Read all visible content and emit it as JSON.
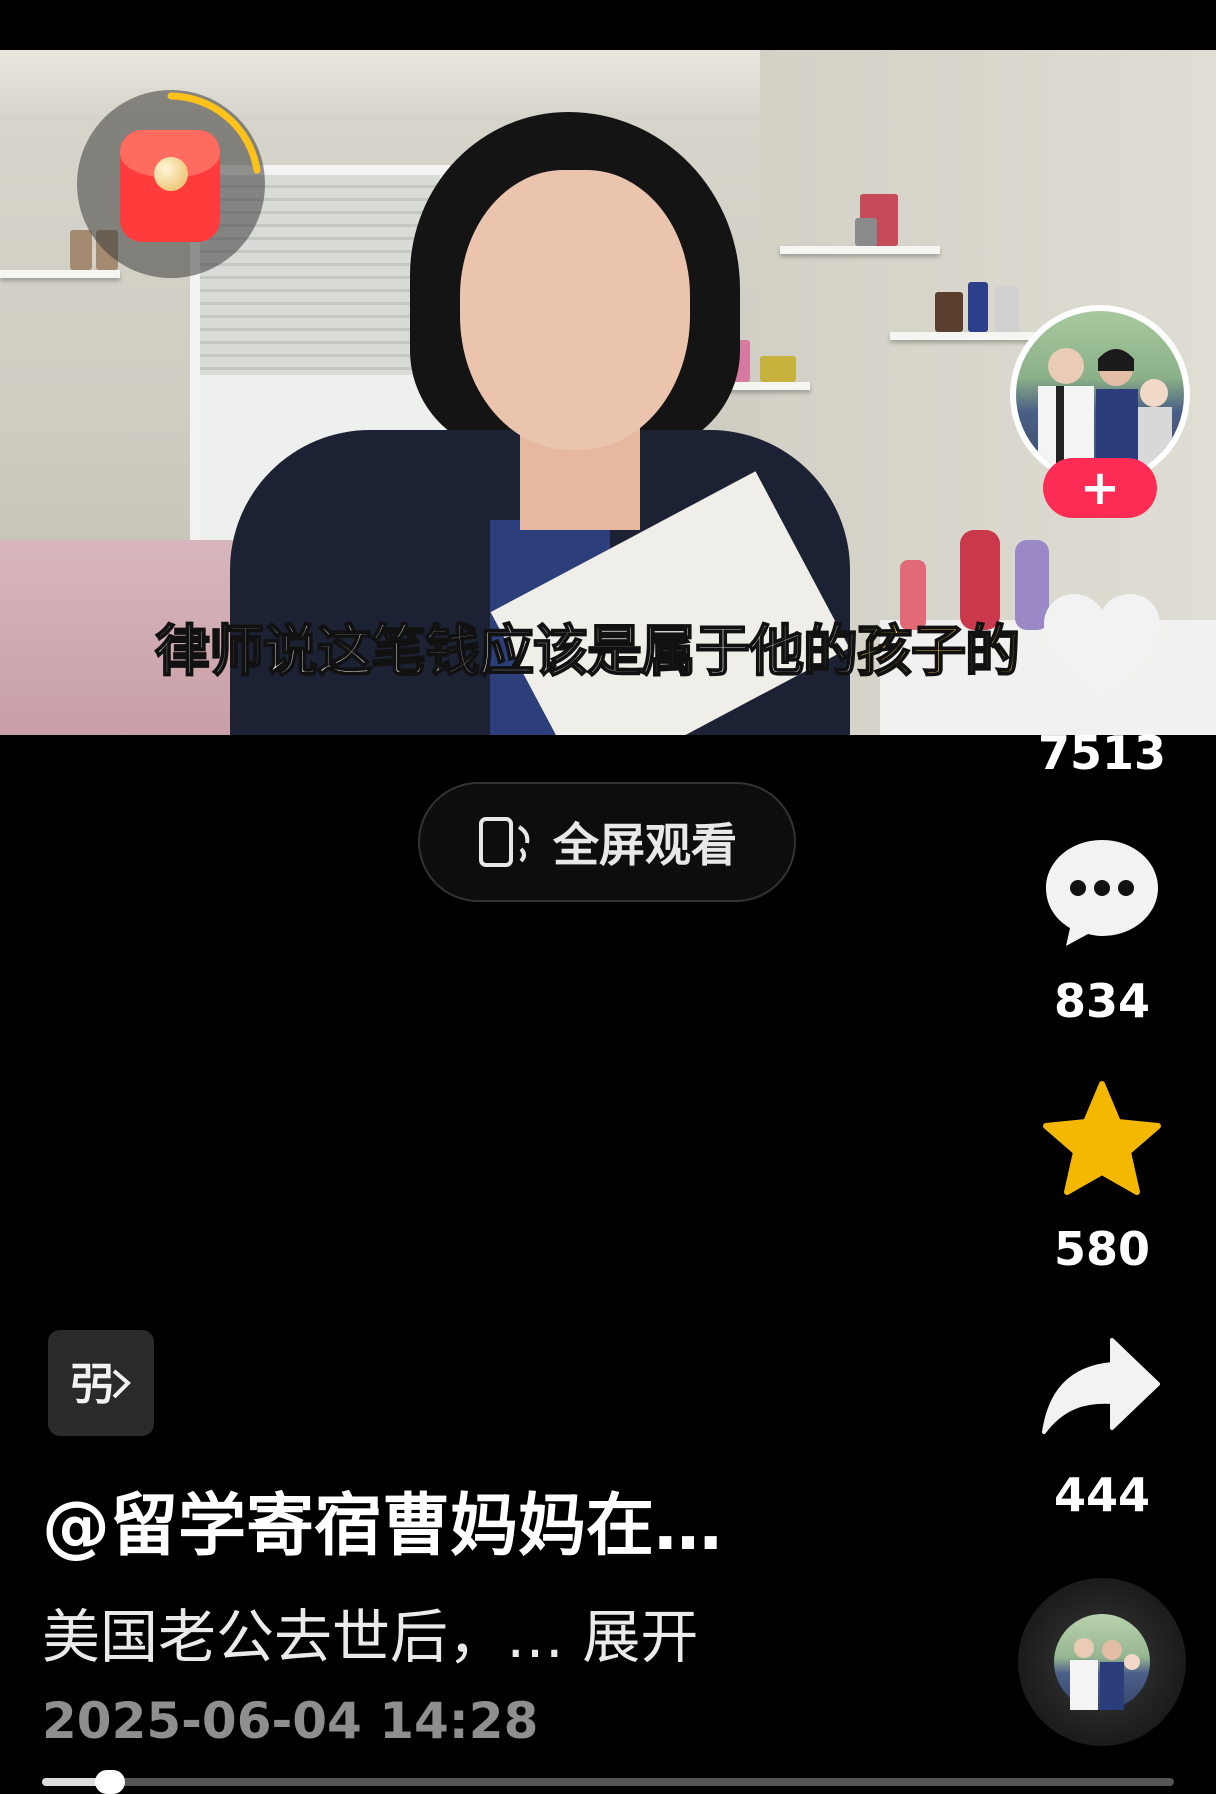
{
  "video": {
    "subtitle_main": "律师说这笔钱应该是属于他的",
    "subtitle_highlight": "孩子的",
    "fullscreen_label": "全屏观看"
  },
  "author": {
    "follow_symbol": "+"
  },
  "actions": {
    "likes": "7513",
    "comments": "834",
    "favorites": "580",
    "shares": "444"
  },
  "info": {
    "badge_icon": "翻译",
    "author_name": "@留学寄宿曹妈妈在…",
    "description": "美国老公去世后，… 展开",
    "timestamp": "2025-06-04 14:28"
  },
  "progress": {
    "fraction": 0.06
  },
  "colors": {
    "background": "#000000",
    "follow_red": "#fe2c55",
    "favorite_gold": "#f5b800",
    "subtitle_highlight": "#ffd84a"
  },
  "icons": [
    "red-packet-icon",
    "heart-icon",
    "comment-icon",
    "star-icon",
    "share-icon",
    "rotate-screen-icon",
    "translate-icon",
    "music-disc-icon"
  ]
}
